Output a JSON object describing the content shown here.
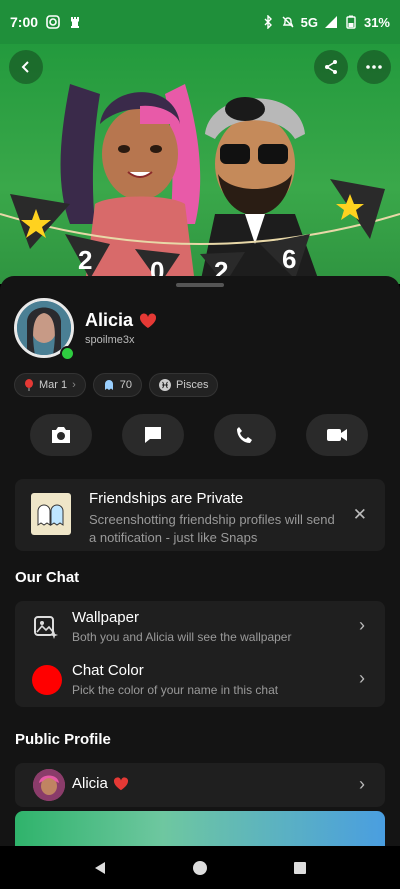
{
  "status_bar": {
    "time": "7:00",
    "network": "5G",
    "battery": "31%"
  },
  "profile": {
    "name": "Alicia",
    "username": "spoilme3x",
    "birthday_chip": "Mar 1",
    "streak_chip": "70",
    "zodiac_chip": "Pisces"
  },
  "privacy_notice": {
    "title": "Friendships are Private",
    "body": "Screenshotting friendship profiles will send a notification - just like Snaps"
  },
  "our_chat": {
    "section_title": "Our Chat",
    "wallpaper_title": "Wallpaper",
    "wallpaper_sub": "Both you and Alicia will see the wallpaper",
    "color_title": "Chat Color",
    "color_sub": "Pick the color of your name in this chat",
    "chat_color": "#ff0000"
  },
  "public_profile": {
    "section_title": "Public Profile",
    "name": "Alicia"
  },
  "hero_banner_digits": [
    "2",
    "0",
    "2",
    "6"
  ],
  "colors": {
    "hero_green": "#2f9a42",
    "online": "#2ecc40",
    "heart": "#e53935"
  }
}
